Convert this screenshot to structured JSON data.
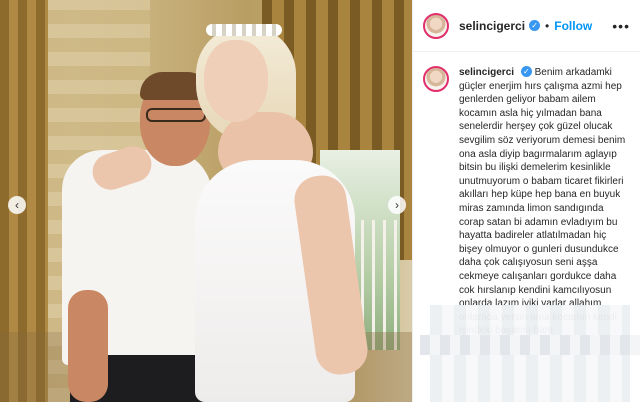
{
  "post": {
    "username": "selincigerci",
    "follow_label": "Follow",
    "more_label": "•••",
    "verified_glyph": "✓",
    "separator": "•",
    "caption_text": "Benim arkadamki güçler enerjim hırs çalışma azmi hep genlerden geliyor babam ailem kocamın asla hiç yılmadan bana senelerdir herşey çok güzel olucak sevgilim söz veriyorum demesi benim ona asla diyip bagırmalarım aglayıp bitsin bu ilişki demelerim kesinlikle unutmuyorum o babam ticaret fikirleri akılları hep küpe hep bana en buyuk miras zamında limon sandıgında corap satan bi adamın evladıyım bu hayatta badireler atlatılmadan hiç bişey olmuyor o gunleri dusundukce daha çok calışıyosun seni aşşa cekmeye calışanları gordukce daha cok hırslanıp kendini kamcılıyosun onlarda lazım iyiki varlar allahım onlarada versin ama kocamın kendi işindeki başarısı bam"
  },
  "carousel": {
    "prev_glyph": "‹",
    "next_glyph": "›"
  },
  "colors": {
    "follow": "#0095f6",
    "verified": "#3897f0",
    "story_ring": "#e1306c"
  }
}
